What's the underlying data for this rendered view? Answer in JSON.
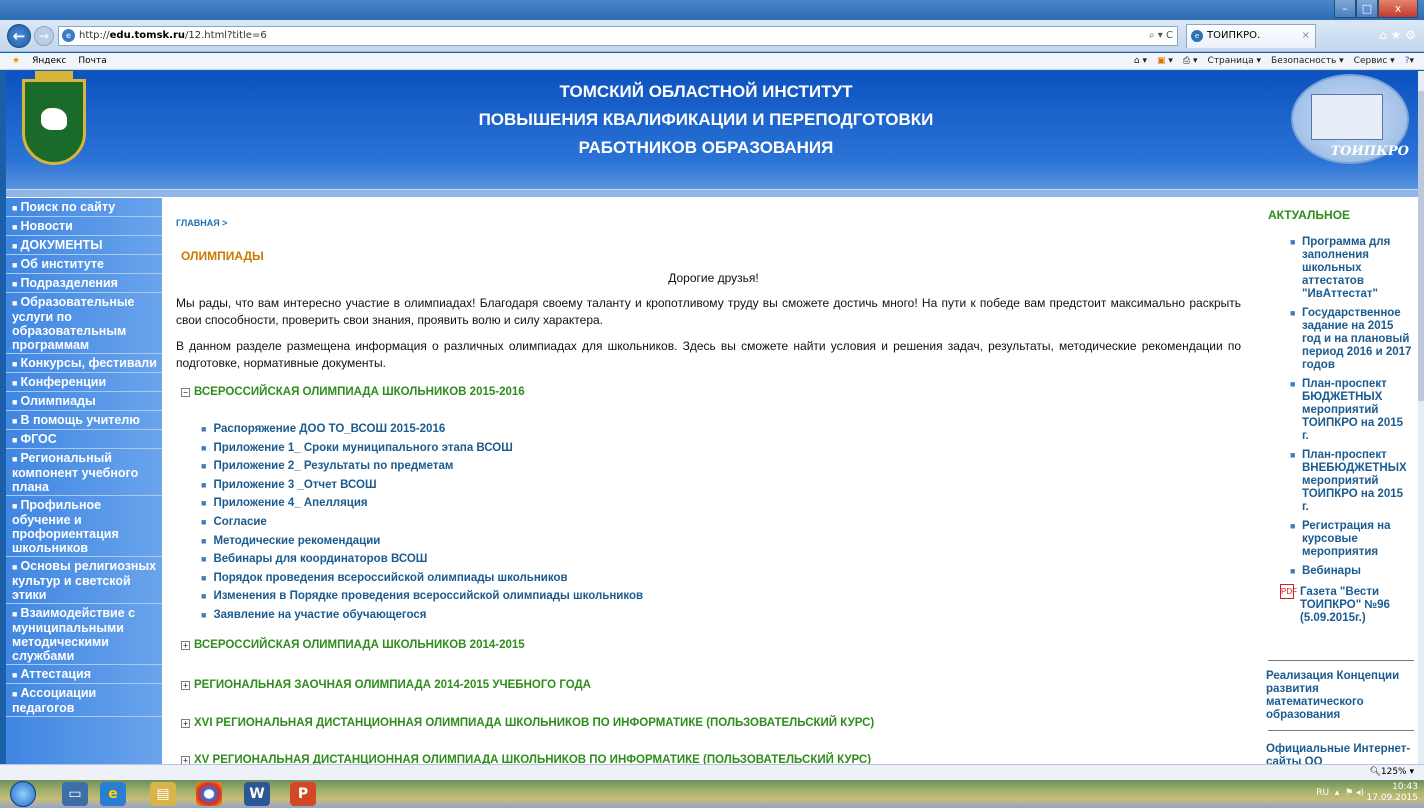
{
  "browser": {
    "url_prefix": "http://",
    "url_domain": "edu.tomsk.ru",
    "url_path": "/12.html?title=6",
    "addr_tools": "⌕ ▾ C",
    "tab_title": "ТОИПКРО. ОЛИМПИАДЫ",
    "tab_close": "×",
    "window_controls": {
      "minimize": "–",
      "maximize": "□",
      "close": "x"
    },
    "right_icons": "⌂ ★ ⚙"
  },
  "favorites": {
    "items": [
      "Яндекс",
      "Почта"
    ],
    "toolbar": [
      "▾",
      "▾",
      "▾",
      "Страница ▾",
      "Безопасность ▾",
      "Сервис ▾",
      "▾"
    ]
  },
  "banner": {
    "line1": "ТОМСКИЙ ОБЛАСТНОЙ ИНСТИТУТ",
    "line2": "ПОВЫШЕНИЯ КВАЛИФИКАЦИИ И ПЕРЕПОДГОТОВКИ",
    "line3": "РАБОТНИКОВ ОБРАЗОВАНИЯ",
    "logo_text": "ТОИПКРО"
  },
  "leftnav": [
    "Поиск по сайту",
    "Новости",
    "ДОКУМЕНТЫ",
    "Об институте",
    "Подразделения",
    "Образовательные услуги по образовательным программам",
    "Конкурсы, фестивали",
    "Конференции",
    "Олимпиады",
    "В помощь учителю",
    "ФГОС",
    "Региональный компонент учебного плана",
    "Профильное обучение и профориентация школьников",
    "Основы религиозных культур и светской этики",
    "Взаимодействие с муниципальными методическими службами",
    "Аттестация",
    "Ассоциации педагогов"
  ],
  "main": {
    "breadcrumb": "ГЛАВНАЯ >",
    "title": "ОЛИМПИАДЫ",
    "greeting": "Дорогие друзья!",
    "p1": "Мы рады, что вам интересно участие в олимпиадах! Благодаря своему таланту и кропотливому труду вы сможете достичь много! На пути к победе вам предстоит максимально раскрыть свои способности, проверить свои знания, проявить волю и силу характера.",
    "p2": "В данном разделе размещена информация о различных олимпиадах для школьников. Здесь вы сможете найти условия и решения задач, результаты, методические рекомендации по подготовке, нормативные документы.",
    "sections": [
      {
        "toggle": "−",
        "title": "ВСЕРОССИЙСКАЯ ОЛИМПИАДА ШКОЛЬНИКОВ 2015-2016"
      },
      {
        "toggle": "+",
        "title": "ВСЕРОССИЙСКАЯ ОЛИМПИАДА ШКОЛЬНИКОВ 2014-2015"
      },
      {
        "toggle": "+",
        "title": "РЕГИОНАЛЬНАЯ ЗАОЧНАЯ ОЛИМПИАДА 2014-2015 УЧЕБНОГО ГОДА"
      },
      {
        "toggle": "+",
        "title": "XVI РЕГИОНАЛЬНАЯ ДИСТАНЦИОННАЯ ОЛИМПИАДА ШКОЛЬНИКОВ ПО ИНФОРМАТИКЕ (ПОЛЬЗОВАТЕЛЬСКИЙ КУРС)"
      },
      {
        "toggle": "+",
        "title": "XV РЕГИОНАЛЬНАЯ ДИСТАНЦИОННАЯ ОЛИМПИАДА ШКОЛЬНИКОВ ПО ИНФОРМАТИКЕ (ПОЛЬЗОВАТЕЛЬСКИЙ КУРС)"
      }
    ],
    "links": [
      "Распоряжение ДОО ТО_ВСОШ 2015-2016",
      "Приложение 1_ Сроки муниципального этапа ВСОШ",
      "Приложение 2_ Результаты по предметам",
      "Приложение 3 _Отчет ВСОШ",
      "Приложение 4_ Апелляция",
      "Согласие",
      "Методические рекомендации",
      "Вебинары для координаторов ВСОШ",
      "Порядок проведения всероссийской олимпиады школьников",
      "Изменения в Порядке проведения всероссийской олимпиады школьников",
      "Заявление на участие обучающегося"
    ]
  },
  "right": {
    "heading": "АКТУАЛЬНОЕ",
    "items": [
      "Программа для заполнения школьных аттестатов \"ИвАттестат\"",
      "Государственное задание на 2015 год и на плановый период 2016 и 2017 годов",
      "План-проспект БЮДЖЕТНЫХ мероприятий ТОИПКРО на 2015 г.",
      "План-проспект ВНЕБЮДЖЕТНЫХ мероприятий ТОИПКРО на 2015 г.",
      "Регистрация на курсовые мероприятия",
      "Вебинары"
    ],
    "pdf_label": "Газета \"Вести ТОИПКРО\" №96 (5.09.2015г.)",
    "pdf_icon": "PDF",
    "link1": "Реализация Концепции развития математического образования",
    "link2": "Официальные Интернет-сайты ОО"
  },
  "status": {
    "zoom": "125%"
  },
  "taskbar": {
    "lang": "RU",
    "time": "10:43",
    "date": "17.09.2015",
    "word_label": "W",
    "ppt_label": "P"
  }
}
